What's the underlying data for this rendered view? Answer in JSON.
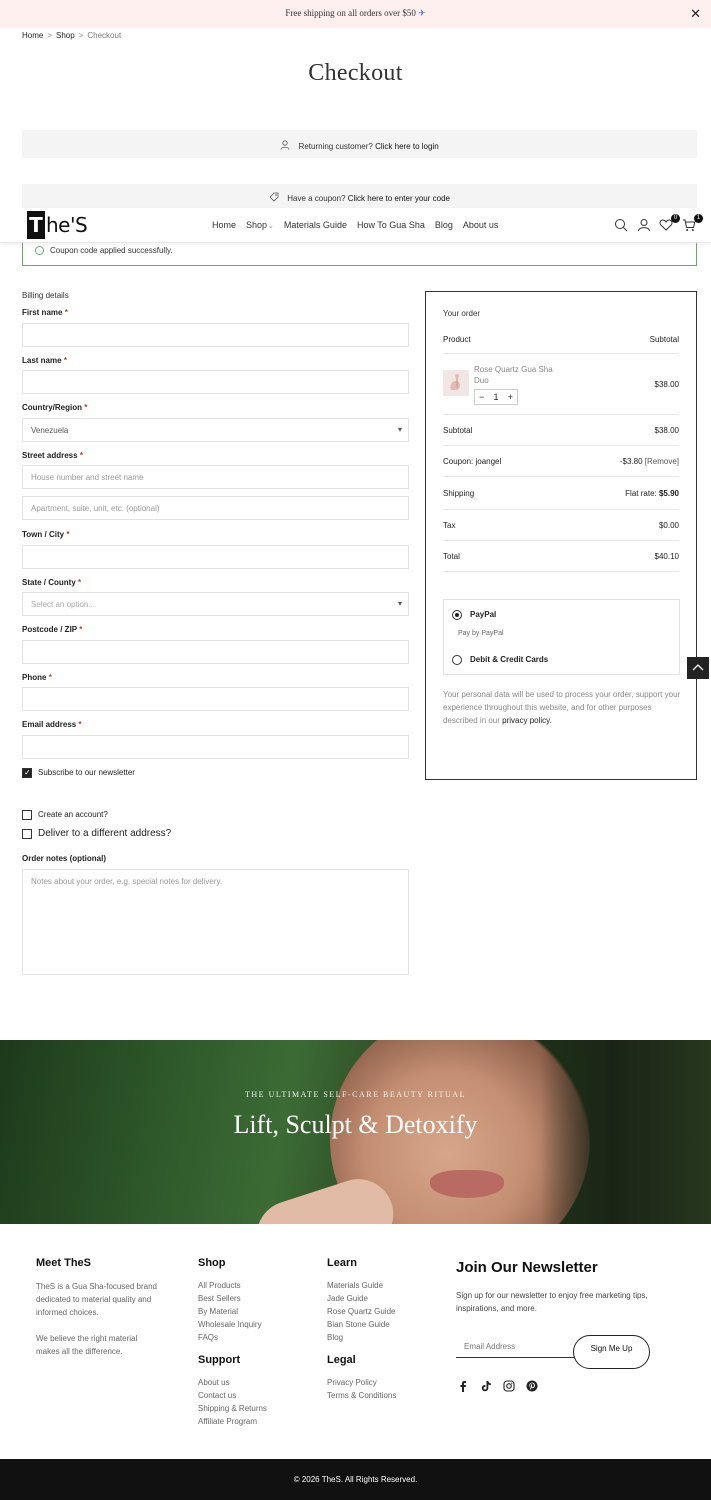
{
  "topbar": {
    "message": "Free shipping on all orders over $50",
    "plane_icon": "✈",
    "close": "✕"
  },
  "breadcrumb": {
    "home": "Home",
    "shop": "Shop",
    "current": "Checkout",
    "sep": ">"
  },
  "page_title": "Checkout",
  "returning": {
    "text": "Returning customer?",
    "link": "Click here to login"
  },
  "coupon_notice": {
    "text": "Have a coupon?",
    "link": "Click here to enter your code"
  },
  "header": {
    "logo_t": "T",
    "logo_rest": "he'S",
    "nav": [
      "Home",
      "Shop",
      "Materials Guide",
      "How To Gua Sha",
      "Blog",
      "About us"
    ],
    "shop_caret": "⌄",
    "wishlist_count": "0",
    "cart_count": "1"
  },
  "coupon_success": "Coupon code applied successfully.",
  "billing": {
    "heading": "Billing details",
    "first_name": "First name",
    "last_name": "Last name",
    "country": "Country/Region",
    "country_value": "Venezuela",
    "street": "Street address",
    "street_ph1": "House number and street name",
    "street_ph2": "Apartment, suite, unit, etc. (optional)",
    "town": "Town / City",
    "state": "State / County",
    "state_ph": "Select an option...",
    "postcode": "Postcode / ZIP",
    "phone": "Phone",
    "email": "Email address",
    "required_mark": "*",
    "subscribe": "Subscribe to our newsletter",
    "create_account": "Create an account?",
    "deliver_different": "Deliver to a different address?",
    "order_notes": "Order notes (optional)",
    "order_notes_ph": "Notes about your order, e.g. special notes for delivery."
  },
  "order": {
    "heading": "Your order",
    "col_product": "Product",
    "col_subtotal": "Subtotal",
    "item_name": "Rose Quartz Gua Sha Duo",
    "item_qty": "1",
    "item_price": "$38.00",
    "qty_minus": "−",
    "qty_plus": "+",
    "subtotal_label": "Subtotal",
    "subtotal": "$38.00",
    "coupon_label": "Coupon: joangel",
    "coupon_value": "-$3.80",
    "coupon_remove": "[Remove]",
    "shipping_label": "Shipping",
    "shipping_prefix": "Flat rate: ",
    "shipping_value": "$5.90",
    "tax_label": "Tax",
    "tax": "$0.00",
    "total_label": "Total",
    "total": "$40.10",
    "paypal": "PayPal",
    "paypal_desc": "Pay by PayPal",
    "cards": "Debit & Credit Cards",
    "privacy_text": "Your personal data will be used to process your order, support your experience throughout this website, and for other purposes described in our",
    "privacy_link": "privacy policy."
  },
  "hero": {
    "subtitle": "THE ULTIMATE SELF-CARE BEAUTY RITUAL",
    "title": "Lift, Sculpt & Detoxify"
  },
  "footer": {
    "about_heading": "Meet TheS",
    "about_p1": "TheS is a Gua Sha-focused brand dedicated to material quality and informed choices.",
    "about_p2": "We believe the right material makes all the difference.",
    "shop_heading": "Shop",
    "shop_links": [
      "All Products",
      "Best Sellers",
      "By Material",
      "Wholesale Inquiry",
      "FAQs"
    ],
    "support_heading": "Support",
    "support_links": [
      "About us",
      "Contact us",
      "Shipping & Returns",
      "Affiliate Program"
    ],
    "learn_heading": "Learn",
    "learn_links": [
      "Materials Guide",
      "Jade Guide",
      "Rose Quartz Guide",
      "Bian Stone Guide",
      "Blog"
    ],
    "legal_heading": "Legal",
    "legal_links": [
      "Privacy Policy",
      "Terms & Conditions"
    ],
    "newsletter_heading": "Join Our Newsletter",
    "newsletter_desc": "Sign up for our newsletter to enjoy free marketing tips, inspirations, and more.",
    "email_placeholder": "Email Address",
    "signup_label": "Sign Me Up",
    "copyright": "© 2026 TheS. All Rights Reserved."
  }
}
